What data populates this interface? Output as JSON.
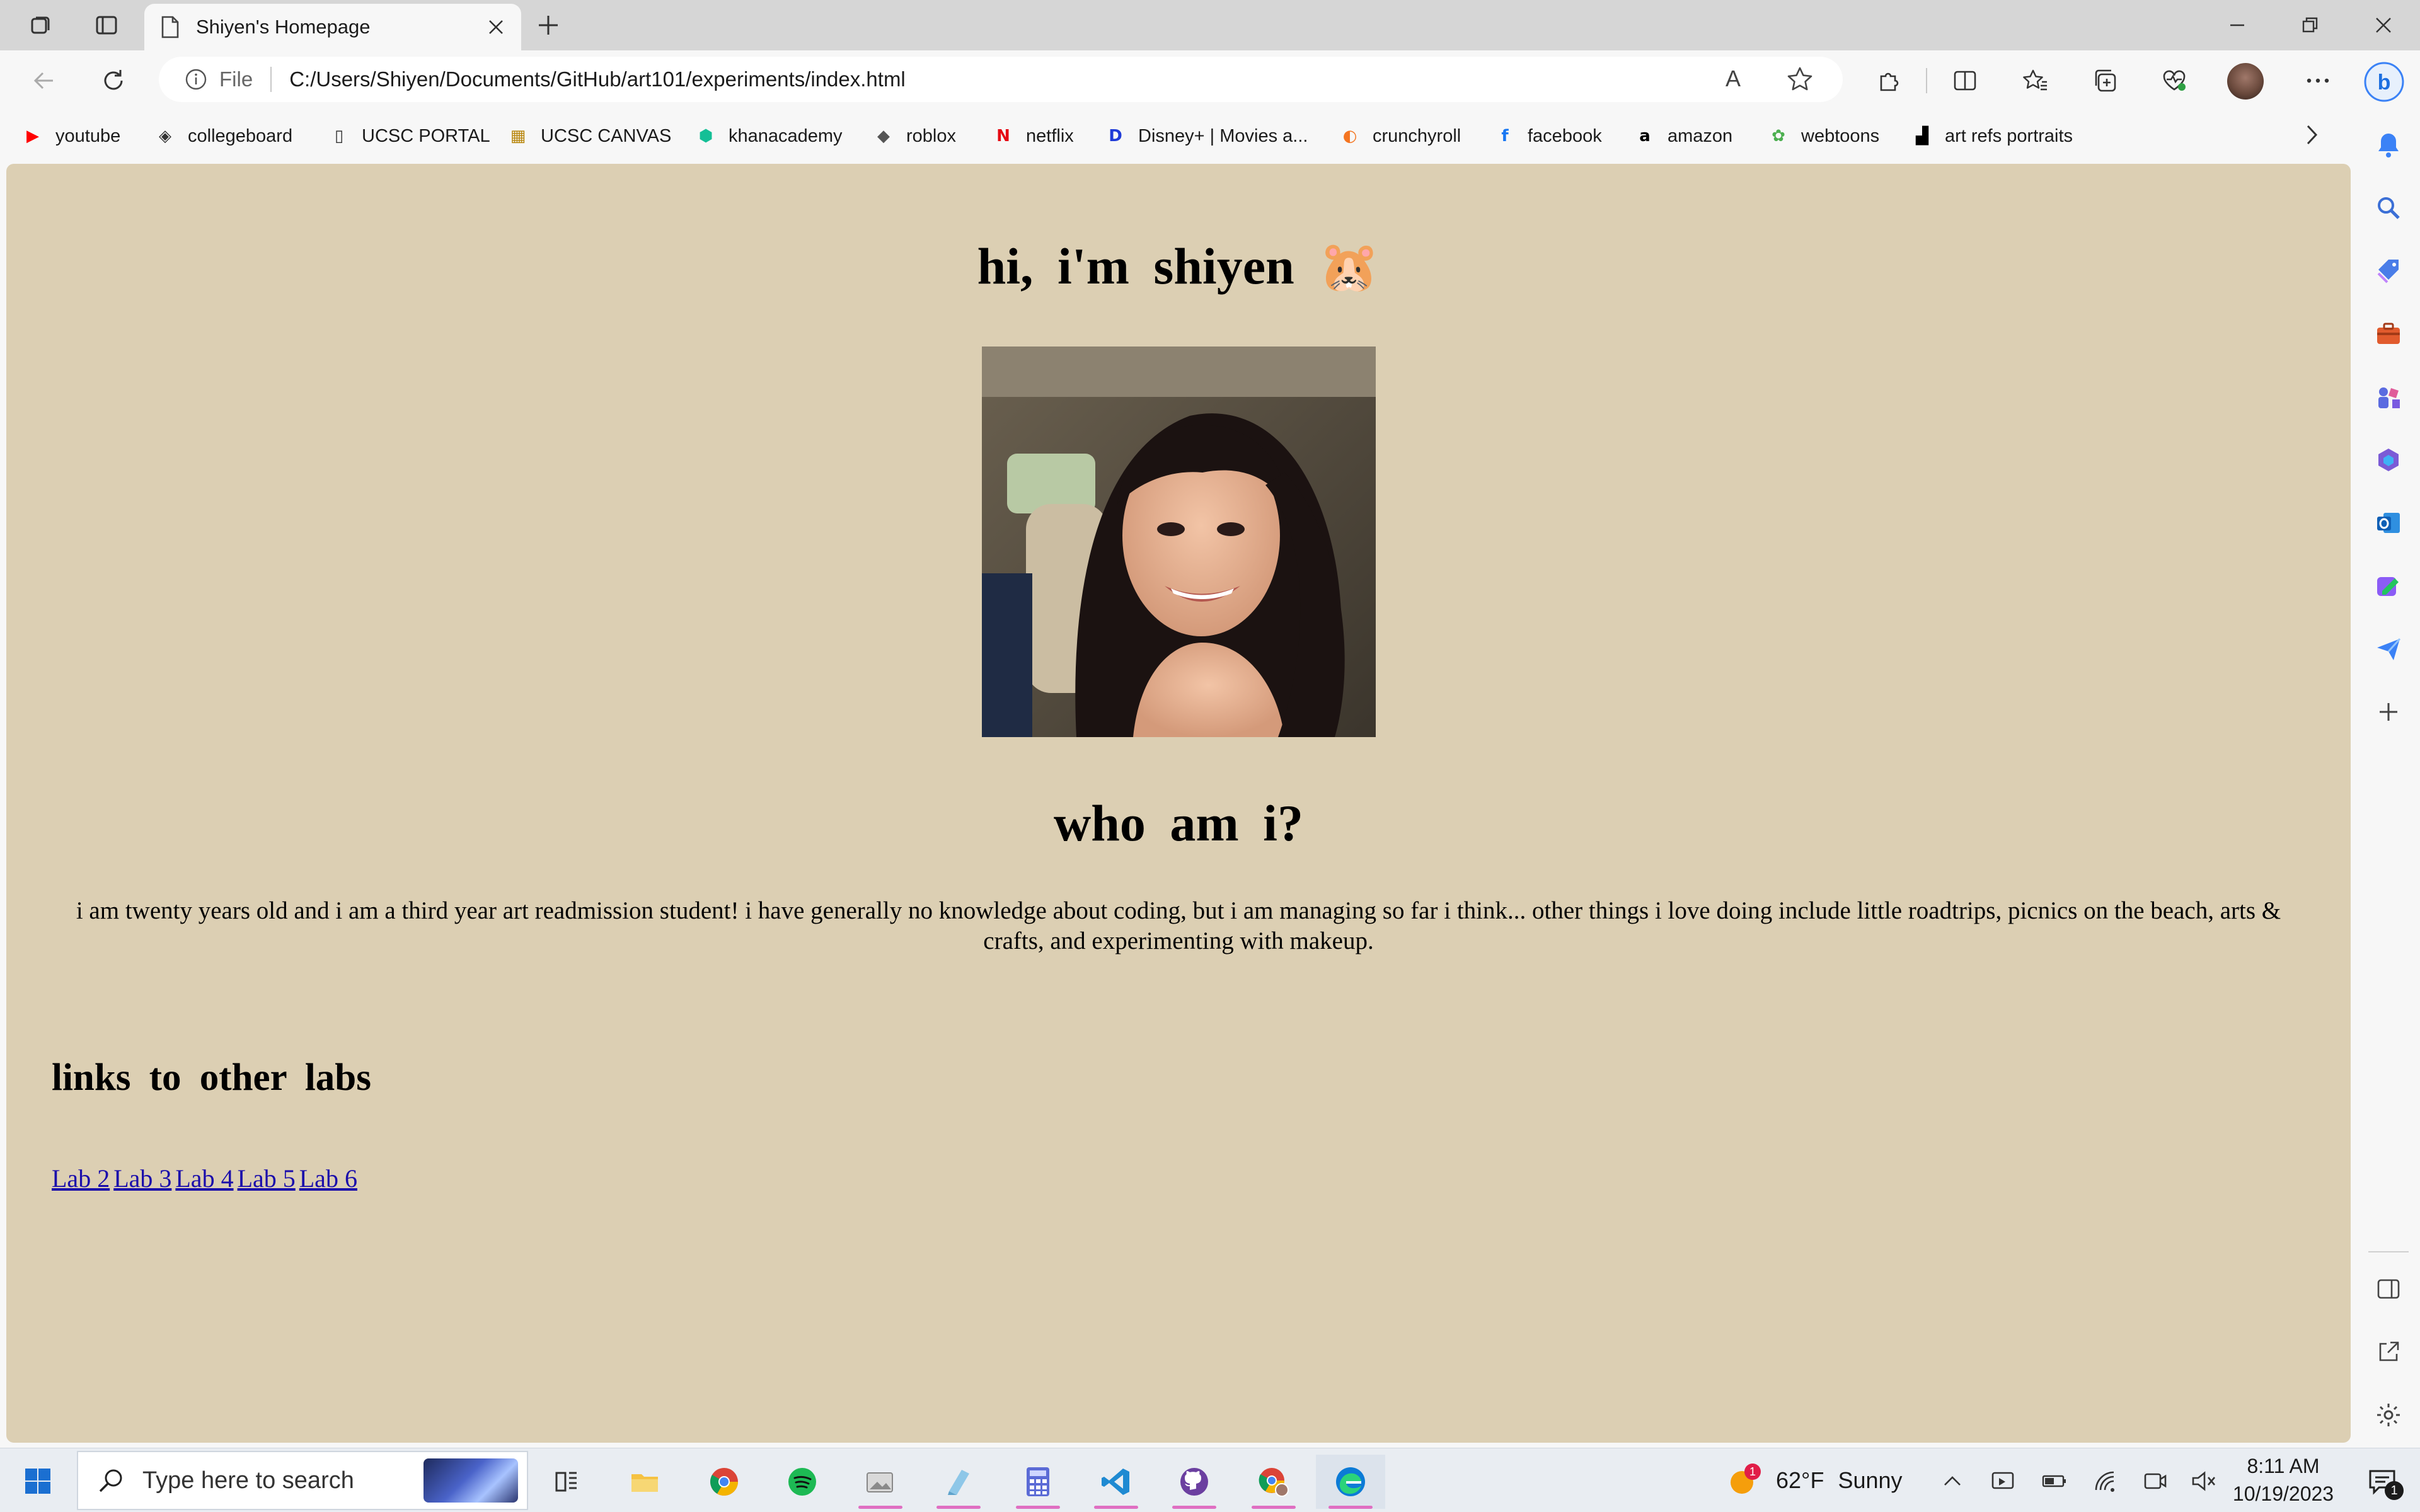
{
  "browser": {
    "tab": {
      "title": "Shiyen's Homepage"
    },
    "address": {
      "scheme": "File",
      "url": "C:/Users/Shiyen/Documents/GitHub/art101/experiments/index.html"
    },
    "read_aloud_label": "A",
    "favorites": [
      {
        "label": "youtube",
        "icon": "youtube-icon",
        "color": "#ff0000"
      },
      {
        "label": "collegeboard",
        "icon": "shield-icon",
        "color": "#333333"
      },
      {
        "label": "UCSC PORTAL",
        "icon": "page-icon",
        "color": "#333333"
      },
      {
        "label": "UCSC CANVAS",
        "icon": "ucsc-icon",
        "color": "#b8860b"
      },
      {
        "label": "khanacademy",
        "icon": "khan-icon",
        "color": "#14bf96"
      },
      {
        "label": "roblox",
        "icon": "roblox-icon",
        "color": "#555555"
      },
      {
        "label": "netflix",
        "icon": "netflix-icon",
        "color": "#e50914"
      },
      {
        "label": "Disney+ | Movies a...",
        "icon": "disney-icon",
        "color": "#1f3bd8"
      },
      {
        "label": "crunchyroll",
        "icon": "crunchyroll-icon",
        "color": "#f47521"
      },
      {
        "label": "facebook",
        "icon": "facebook-icon",
        "color": "#1877f2"
      },
      {
        "label": "amazon",
        "icon": "amazon-icon",
        "color": "#000000"
      },
      {
        "label": "webtoons",
        "icon": "webtoons-icon",
        "color": "#4caf50"
      },
      {
        "label": "art refs portraits",
        "icon": "unsplash-icon",
        "color": "#000000"
      }
    ]
  },
  "page": {
    "heading_hi": "hi, i'm shiyen",
    "heading_emoji": "🐹",
    "portrait_alt": "portrait photo",
    "heading_who": "who am i?",
    "bio": "i am twenty years old and i am a third year art readmission student! i have generally no knowledge about coding, but i am managing so far i think... other things i love doing include little roadtrips, picnics on the beach, arts & crafts, and experimenting with makeup.",
    "heading_links": "links to other labs",
    "labs": [
      "Lab 2",
      "Lab 3",
      "Lab 4",
      "Lab 5",
      "Lab 6"
    ],
    "background_color": "#dccfb3"
  },
  "taskbar": {
    "search_placeholder": "Type here to search",
    "weather": {
      "temp": "62°F",
      "condition": "Sunny",
      "badge": "1"
    },
    "time": "8:11 AM",
    "date": "10/19/2023",
    "notification_count": "1"
  }
}
